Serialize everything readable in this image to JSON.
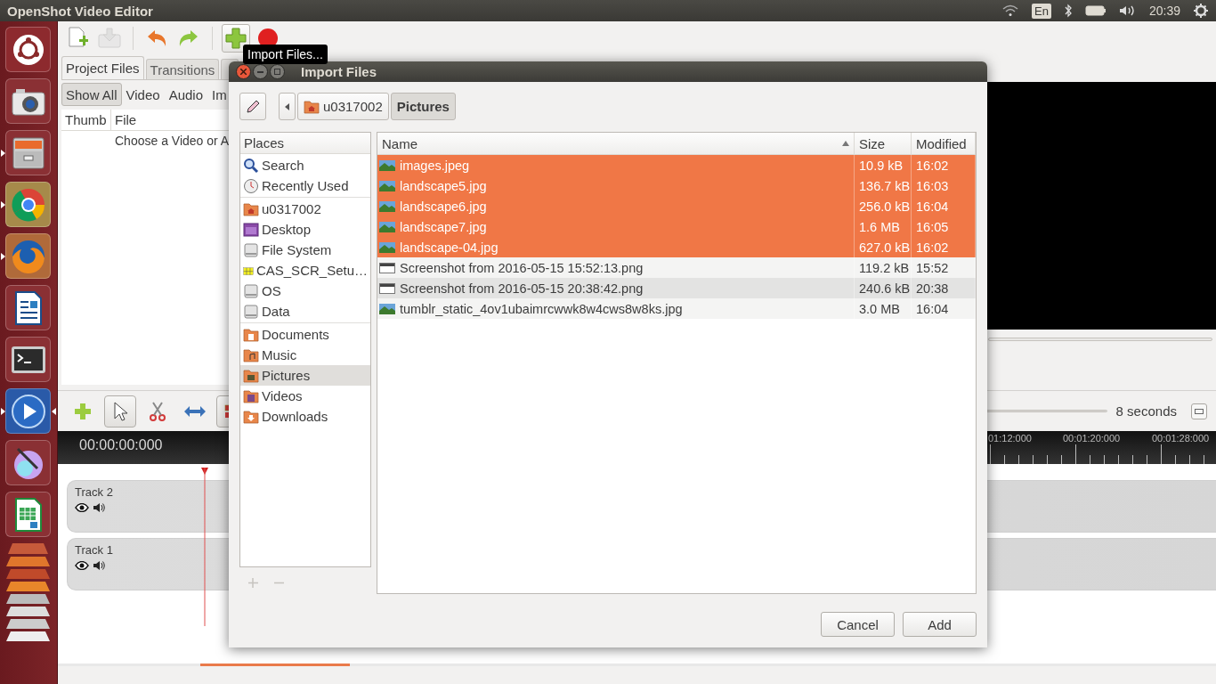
{
  "top_bar": {
    "title": "OpenShot Video Editor",
    "keyboard_layout": "En",
    "clock": "20:39"
  },
  "launcher": [
    {
      "kind": "dash",
      "running": false,
      "focused": false
    },
    {
      "kind": "camera",
      "running": false,
      "focused": false
    },
    {
      "kind": "files",
      "running": true,
      "focused": false
    },
    {
      "kind": "browser",
      "running": true,
      "focused": false
    },
    {
      "kind": "fox",
      "running": true,
      "focused": false
    },
    {
      "kind": "writer",
      "running": false,
      "focused": false
    },
    {
      "kind": "terminal",
      "running": false,
      "focused": false
    },
    {
      "kind": "player",
      "running": true,
      "focused": true
    },
    {
      "kind": "paint",
      "running": false,
      "focused": false
    },
    {
      "kind": "calc",
      "running": false,
      "focused": false
    }
  ],
  "toolbar": [
    [
      {
        "kind": "new",
        "disabled": false,
        "hovered": false
      },
      {
        "kind": "save",
        "disabled": true,
        "hovered": false
      }
    ],
    [
      {
        "kind": "undo",
        "disabled": false,
        "hovered": false
      },
      {
        "kind": "redo",
        "disabled": false,
        "hovered": false
      }
    ],
    [
      {
        "kind": "import",
        "disabled": false,
        "hovered": true
      },
      {
        "kind": "record",
        "disabled": false,
        "hovered": false
      }
    ]
  ],
  "tooltip": "Import Files...",
  "project_tabs": [
    {
      "label": "Project Files",
      "selected": true
    },
    {
      "label": "Transitions",
      "selected": false
    },
    {
      "selected": false
    }
  ],
  "filters": [
    {
      "label": "Show All",
      "selected": true
    },
    {
      "label": "Video",
      "selected": false
    },
    {
      "label": "Audio",
      "selected": false
    },
    {
      "label": "Im",
      "selected": false
    }
  ],
  "files_table": {
    "columns": [
      "Thumb",
      "File"
    ],
    "rows": [
      {
        "file": "Choose a Video or A"
      }
    ]
  },
  "timeline": {
    "tools": [
      {
        "kind": "add",
        "selected": false
      },
      {
        "kind": "pointer",
        "selected": true
      },
      {
        "kind": "razor",
        "selected": false
      },
      {
        "kind": "resize",
        "selected": false
      },
      {
        "kind": "snap",
        "selected": true
      }
    ],
    "zoom_label": "8 seconds",
    "timecode": "00:00:00:000",
    "ruler_labels": [
      "01:12:000",
      "00:01:20:000",
      "00:01:28:000"
    ],
    "tracks": [
      {
        "name": "Track 2",
        "visible": true,
        "audible": true
      },
      {
        "name": "Track 1",
        "visible": true,
        "audible": true
      }
    ]
  },
  "dialog": {
    "title": "Import Files",
    "path": [
      {
        "label": "u0317002",
        "selected": false
      },
      {
        "label": "Pictures",
        "selected": true
      }
    ],
    "places_header": "Places",
    "places": [
      [
        {
          "label": "Search",
          "kind": "search",
          "selected": false
        },
        {
          "label": "Recently Used",
          "kind": "recent",
          "selected": false
        }
      ],
      [
        {
          "label": "u0317002",
          "kind": "home",
          "selected": false
        },
        {
          "label": "Desktop",
          "kind": "desktop",
          "selected": false
        },
        {
          "label": "File System",
          "kind": "drive",
          "selected": false
        },
        {
          "label": "CAS_SCR_Setu…",
          "kind": "package",
          "selected": false
        },
        {
          "label": "OS",
          "kind": "drive",
          "selected": false
        },
        {
          "label": "Data",
          "kind": "drive",
          "selected": false
        }
      ],
      [
        {
          "label": "Documents",
          "kind": "documents",
          "selected": false
        },
        {
          "label": "Music",
          "kind": "music",
          "selected": false
        },
        {
          "label": "Pictures",
          "kind": "pictures",
          "selected": true
        },
        {
          "label": "Videos",
          "kind": "videos",
          "selected": false
        },
        {
          "label": "Downloads",
          "kind": "downloads",
          "selected": false
        }
      ]
    ],
    "columns": [
      "Name",
      "Size",
      "Modified"
    ],
    "files": [
      {
        "name": "images.jpeg",
        "size": "10.9 kB",
        "modified": "16:02",
        "kind": "photo",
        "selected": true
      },
      {
        "name": "landscape5.jpg",
        "size": "136.7 kB",
        "modified": "16:03",
        "kind": "photo",
        "selected": true
      },
      {
        "name": "landscape6.jpg",
        "size": "256.0 kB",
        "modified": "16:04",
        "kind": "photo",
        "selected": true
      },
      {
        "name": "landscape7.jpg",
        "size": "1.6 MB",
        "modified": "16:05",
        "kind": "photo",
        "selected": true
      },
      {
        "name": "landscape-04.jpg",
        "size": "627.0 kB",
        "modified": "16:02",
        "kind": "photo",
        "selected": true
      },
      {
        "name": "Screenshot from 2016-05-15 15:52:13.png",
        "size": "119.2 kB",
        "modified": "15:52",
        "kind": "screenshot",
        "selected": false
      },
      {
        "name": "Screenshot from 2016-05-15 20:38:42.png",
        "size": "240.6 kB",
        "modified": "20:38",
        "kind": "screenshot",
        "selected": false
      },
      {
        "name": "tumblr_static_4ov1ubaimrcwwk8w4cws8w8ks.jpg",
        "size": "3.0 MB",
        "modified": "16:04",
        "kind": "photo",
        "selected": false
      }
    ],
    "buttons": [
      "Cancel",
      "Add"
    ]
  }
}
